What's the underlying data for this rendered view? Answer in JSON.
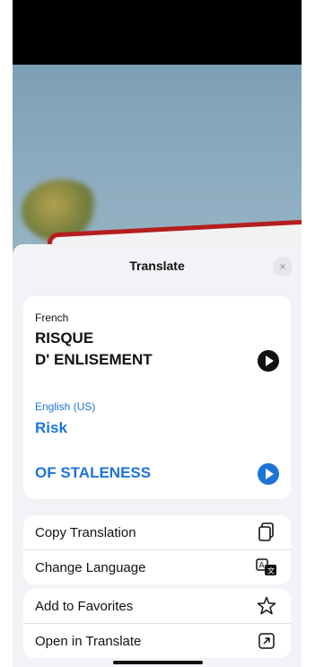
{
  "sheet": {
    "title": "Translate",
    "close_label": "×"
  },
  "translation": {
    "source_language": "French",
    "source_lines": [
      "RISQUE",
      "D' ENLISEMENT"
    ],
    "target_language": "English (US)",
    "target_lines": [
      "Risk",
      "OF STALENESS"
    ]
  },
  "actions": [
    {
      "label": "Copy Translation",
      "icon": "copy-icon"
    },
    {
      "label": "Change Language",
      "icon": "translate-icon"
    },
    {
      "label": "Add to Favorites",
      "icon": "star-icon"
    },
    {
      "label": "Open in Translate",
      "icon": "open-external-icon"
    }
  ],
  "colors": {
    "accent": "#1d74d7",
    "sheet_background": "#f2f2f7",
    "sign_border": "#b51e1e"
  }
}
